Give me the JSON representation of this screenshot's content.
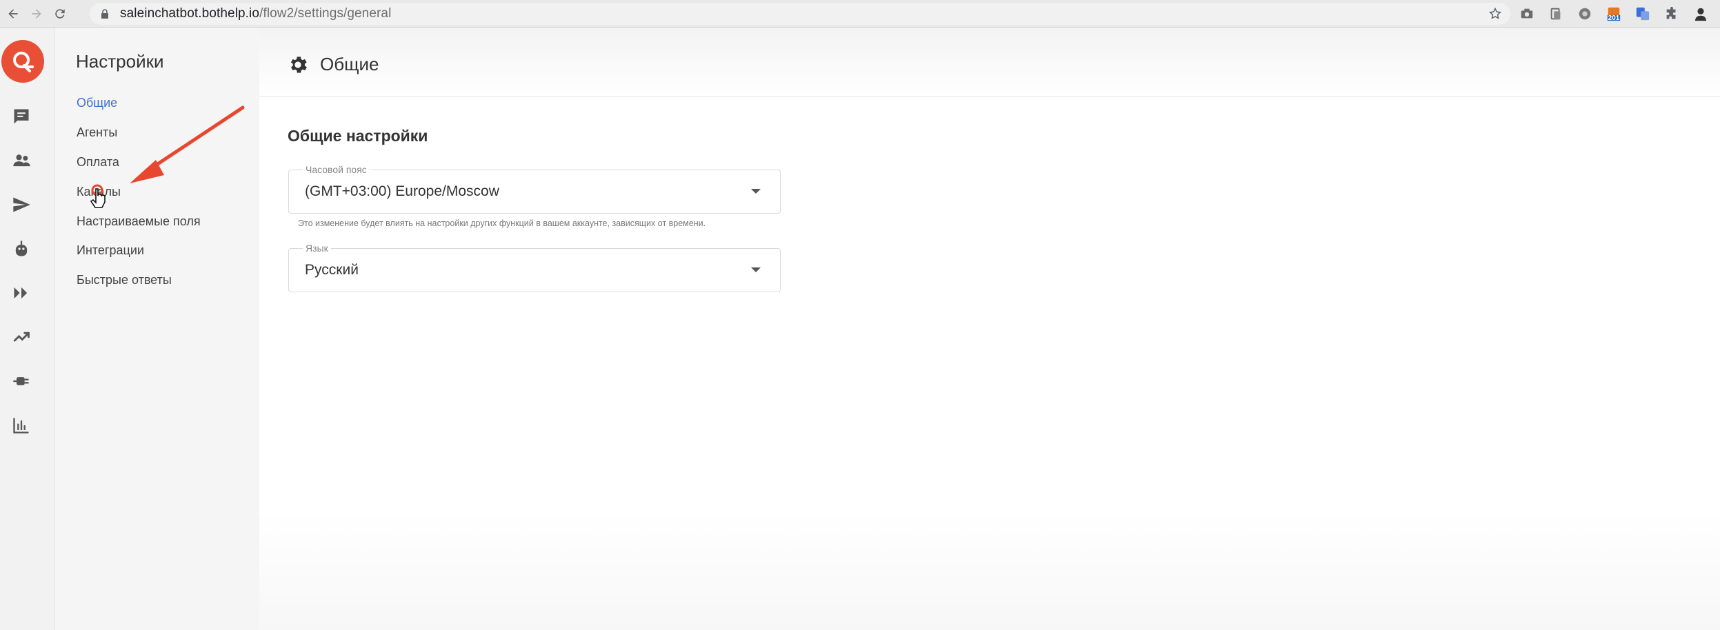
{
  "browser": {
    "url_host": "saleinchatbot.bothelp.io",
    "url_path": "/flow2/settings/general",
    "extensions": [
      "camera-extension-icon",
      "clipboard-extension-icon",
      "globe-extension-icon",
      "rss-counter-extension-icon",
      "translate-extension-icon",
      "puzzle-extensions-icon",
      "profile-avatar"
    ],
    "badge_count": "201"
  },
  "sidebar": {
    "title": "Настройки",
    "items": [
      {
        "label": "Общие",
        "active": true
      },
      {
        "label": "Агенты",
        "active": false
      },
      {
        "label": "Оплата",
        "active": false
      },
      {
        "label": "Каналы",
        "active": false
      },
      {
        "label": "Настраиваемые поля",
        "active": false
      },
      {
        "label": "Интеграции",
        "active": false
      },
      {
        "label": "Быстрые ответы",
        "active": false
      }
    ]
  },
  "rail": {
    "icons": [
      "chat-icon",
      "users-icon",
      "send-icon",
      "bot-icon",
      "flows-icon",
      "trending-icon",
      "plug-icon",
      "stats-icon"
    ]
  },
  "main": {
    "title": "Общие",
    "section_title": "Общие настройки",
    "timezone": {
      "label": "Часовой пояс",
      "value": "(GMT+03:00) Europe/Moscow",
      "helper": "Это изменение будет влиять на настройки других функций в вашем аккаунте, зависящих от времени."
    },
    "language": {
      "label": "Язык",
      "value": "Русский"
    }
  },
  "colors": {
    "brand": "#e94f37",
    "active_link": "#3f6fd1",
    "annotation_arrow": "#e8472f"
  }
}
